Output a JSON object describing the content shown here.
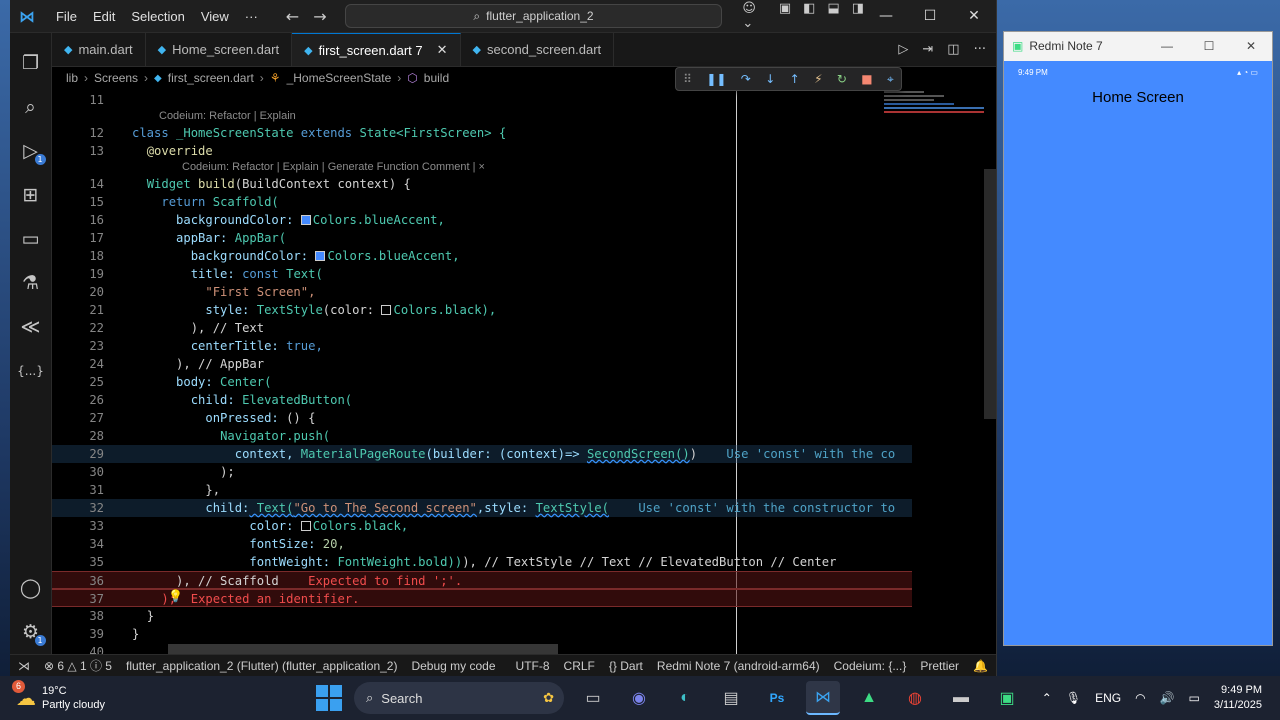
{
  "menu": [
    "File",
    "Edit",
    "Selection",
    "View",
    "···"
  ],
  "search_text": "flutter_application_2",
  "tabs": [
    {
      "label": "main.dart",
      "active": false
    },
    {
      "label": "Home_screen.dart",
      "active": false
    },
    {
      "label": "first_screen.dart 7",
      "active": true
    },
    {
      "label": "second_screen.dart",
      "active": false
    }
  ],
  "breadcrumb": [
    "lib",
    "Screens",
    "first_screen.dart",
    "_HomeScreenState",
    "build"
  ],
  "codelens": {
    "line12": "Codeium: Refactor | Explain",
    "line14": "Codeium: Refactor | Explain | Generate Function Comment | ×"
  },
  "line_numbers": [
    "11",
    "12",
    "13",
    "14",
    "15",
    "16",
    "17",
    "18",
    "19",
    "20",
    "21",
    "22",
    "23",
    "24",
    "25",
    "26",
    "27",
    "28",
    "29",
    "30",
    "31",
    "32",
    "33",
    "34",
    "35",
    "36",
    "37",
    "38",
    "39",
    "40"
  ],
  "code": {
    "l12_kw1": "class",
    "l12_name": " _HomeScreenState ",
    "l12_kw2": "extends",
    "l12_rest": " State<FirstScreen> {",
    "l13": "@override",
    "l14_type": "Widget",
    "l14_fn": " build",
    "l14_rest": "(BuildContext context) {",
    "l15_kw": "return",
    "l15_rest": " Scaffold(",
    "l16_prop": "backgroundColor:",
    "l16_val": "Colors.blueAccent,",
    "l17_prop": "appBar:",
    "l17_rest": " AppBar(",
    "l18_prop": "backgroundColor:",
    "l18_val": "Colors.blueAccent,",
    "l19_prop": "title:",
    "l19_kw": " const",
    "l19_rest": " Text(",
    "l20": "\"First Screen\",",
    "l21_prop": "style:",
    "l21_cls": " TextStyle",
    "l21_mid": "(color: ",
    "l21_val": "Colors.black),",
    "l22": "), // Text",
    "l23_prop": "centerTitle:",
    "l23_val": " true,",
    "l24": "), // AppBar",
    "l25_prop": "body:",
    "l25_rest": " Center(",
    "l26_prop": "child:",
    "l26_rest": " ElevatedButton(",
    "l27_prop": "onPressed:",
    "l27_rest": " () {",
    "l28": "Navigator.push(",
    "l29_a": "context, ",
    "l29_b": "MaterialPageRoute",
    "l29_c": "(builder: (context)=> ",
    "l29_d": "SecondScreen()",
    "l29_e": ")",
    "l29_hint": "Use 'const' with the co",
    "l30": ");",
    "l31": "},",
    "l32_prop": "child:",
    "l32_a": " Text(",
    "l32_str": "\"Go to The Second screen\"",
    "l32_b": ",style: ",
    "l32_c": "TextStyle(",
    "l32_hint": "Use 'const' with the constructor to",
    "l33_prop": "color:",
    "l33_val": "Colors.black,",
    "l34_prop": "fontSize:",
    "l34_val": " 20,",
    "l35_prop": "fontWeight:",
    "l35_val": " FontWeight.bold))",
    "l35_rest": "), // TextStyle // Text // ElevatedButton // Center",
    "l36": "), // Scaffold",
    "l36_err": "Expected to find ';'.",
    "l37": ");",
    "l37_err": "Expected an identifier.",
    "l38": "}",
    "l39": "}"
  },
  "statusbar": {
    "errors": "⊗ 6 △ 1 ⓘ 5",
    "project": "flutter_application_2 (Flutter) (flutter_application_2)",
    "debug": "Debug my code",
    "encoding": "UTF-8",
    "eol": "CRLF",
    "language": "{} Dart",
    "device": "Redmi Note 7 (android-arm64)",
    "codeium": "Codeium: {...}",
    "prettier": "Prettier"
  },
  "emulator": {
    "window_title": "Redmi Note 7",
    "status_time": "9:49 PM",
    "screen_title": "Home Screen",
    "bg_color": "#448aff"
  },
  "taskbar": {
    "weather_temp": "19°C",
    "weather_desc": "Partly cloudy",
    "weather_badge": "6",
    "search": "Search",
    "lang": "ENG",
    "time": "9:49 PM",
    "date": "3/11/2025"
  }
}
